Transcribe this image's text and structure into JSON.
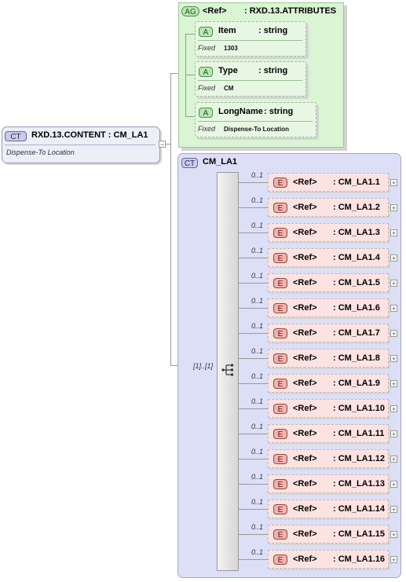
{
  "root": {
    "badge": "CT",
    "title": "RXD.13.CONTENT : CM_LA1",
    "documentation": "Dispense-To Location"
  },
  "attribute_group": {
    "badge": "AG",
    "ref_label": "<Ref>",
    "name": ": RXD.13.ATTRIBUTES",
    "attributes": [
      {
        "badge": "A",
        "name": "Item",
        "type": ": string",
        "fixed_label": "Fixed",
        "fixed_value": "1303"
      },
      {
        "badge": "A",
        "name": "Type",
        "type": ": string",
        "fixed_label": "Fixed",
        "fixed_value": "CM"
      },
      {
        "badge": "A",
        "name": "LongName",
        "type": ": string",
        "fixed_label": "Fixed",
        "fixed_value": "Dispense-To Location"
      }
    ]
  },
  "complex_type": {
    "badge": "CT",
    "name": "CM_LA1",
    "sequence_occurrence": "[1]..[1]",
    "elements": [
      {
        "badge": "E",
        "ref": "<Ref>",
        "name": ": CM_LA1.1",
        "occurrence": "0..1"
      },
      {
        "badge": "E",
        "ref": "<Ref>",
        "name": ": CM_LA1.2",
        "occurrence": "0..1"
      },
      {
        "badge": "E",
        "ref": "<Ref>",
        "name": ": CM_LA1.3",
        "occurrence": "0..1"
      },
      {
        "badge": "E",
        "ref": "<Ref>",
        "name": ": CM_LA1.4",
        "occurrence": "0..1"
      },
      {
        "badge": "E",
        "ref": "<Ref>",
        "name": ": CM_LA1.5",
        "occurrence": "0..1"
      },
      {
        "badge": "E",
        "ref": "<Ref>",
        "name": ": CM_LA1.6",
        "occurrence": "0..1"
      },
      {
        "badge": "E",
        "ref": "<Ref>",
        "name": ": CM_LA1.7",
        "occurrence": "0..1"
      },
      {
        "badge": "E",
        "ref": "<Ref>",
        "name": ": CM_LA1.8",
        "occurrence": "0..1"
      },
      {
        "badge": "E",
        "ref": "<Ref>",
        "name": ": CM_LA1.9",
        "occurrence": "0..1"
      },
      {
        "badge": "E",
        "ref": "<Ref>",
        "name": ": CM_LA1.10",
        "occurrence": "0..1"
      },
      {
        "badge": "E",
        "ref": "<Ref>",
        "name": ": CM_LA1.11",
        "occurrence": "0..1"
      },
      {
        "badge": "E",
        "ref": "<Ref>",
        "name": ": CM_LA1.12",
        "occurrence": "0..1"
      },
      {
        "badge": "E",
        "ref": "<Ref>",
        "name": ": CM_LA1.13",
        "occurrence": "0..1"
      },
      {
        "badge": "E",
        "ref": "<Ref>",
        "name": ": CM_LA1.14",
        "occurrence": "0..1"
      },
      {
        "badge": "E",
        "ref": "<Ref>",
        "name": ": CM_LA1.15",
        "occurrence": "0..1"
      },
      {
        "badge": "E",
        "ref": "<Ref>",
        "name": ": CM_LA1.16",
        "occurrence": "0..1"
      }
    ]
  }
}
